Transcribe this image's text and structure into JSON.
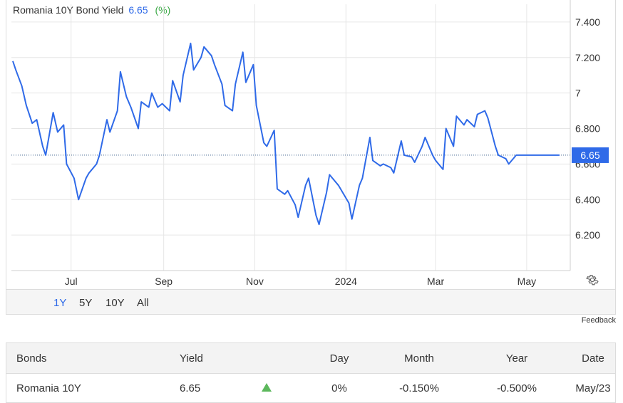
{
  "header": {
    "title": "Romania 10Y Bond Yield",
    "value": "6.65",
    "change": "(%)"
  },
  "colors": {
    "line": "#2f6ae8",
    "grid": "#e6e6e6",
    "last_label_bg": "#2f6ae8",
    "positive": "#3aa845"
  },
  "range_buttons": [
    {
      "label": "1Y",
      "active": true
    },
    {
      "label": "5Y",
      "active": false
    },
    {
      "label": "10Y",
      "active": false
    },
    {
      "label": "All",
      "active": false
    }
  ],
  "settings_icon": "gear-icon",
  "feedback_label": "Feedback",
  "chart_data": {
    "type": "line",
    "title": "Romania 10Y Bond Yield",
    "xlabel": "",
    "ylabel": "",
    "ylim": [
      6.0,
      7.5
    ],
    "yticks": [
      {
        "value": 6.2,
        "label": "6.200"
      },
      {
        "value": 6.4,
        "label": "6.400"
      },
      {
        "value": 6.6,
        "label": "6.600"
      },
      {
        "value": 6.8,
        "label": "6.800"
      },
      {
        "value": 7.0,
        "label": "7"
      },
      {
        "value": 7.2,
        "label": "7.200"
      },
      {
        "value": 7.4,
        "label": "7.400"
      }
    ],
    "xticks": [
      {
        "date": "2023-07-01",
        "label": "Jul"
      },
      {
        "date": "2023-09-01",
        "label": "Sep"
      },
      {
        "date": "2023-11-01",
        "label": "Nov"
      },
      {
        "date": "2024-01-01",
        "label": "2024"
      },
      {
        "date": "2024-03-01",
        "label": "Mar"
      },
      {
        "date": "2024-05-01",
        "label": "May"
      }
    ],
    "last_value": 6.65,
    "last_label": "6.65",
    "grid": true,
    "series": [
      {
        "x": [
          "2023-05-23",
          "2023-05-25",
          "2023-05-29",
          "2023-06-01",
          "2023-06-05",
          "2023-06-08",
          "2023-06-12",
          "2023-06-14",
          "2023-06-19",
          "2023-06-22",
          "2023-06-26",
          "2023-06-28",
          "2023-07-03",
          "2023-07-06",
          "2023-07-11",
          "2023-07-13",
          "2023-07-18",
          "2023-07-20",
          "2023-07-25",
          "2023-07-27",
          "2023-08-01",
          "2023-08-03",
          "2023-08-07",
          "2023-08-10",
          "2023-08-15",
          "2023-08-17",
          "2023-08-22",
          "2023-08-24",
          "2023-08-28",
          "2023-08-31",
          "2023-09-05",
          "2023-09-07",
          "2023-09-12",
          "2023-09-14",
          "2023-09-19",
          "2023-09-21",
          "2023-09-26",
          "2023-09-28",
          "2023-10-03",
          "2023-10-05",
          "2023-10-10",
          "2023-10-12",
          "2023-10-17",
          "2023-10-19",
          "2023-10-24",
          "2023-10-26",
          "2023-10-31",
          "2023-11-02",
          "2023-11-07",
          "2023-11-09",
          "2023-11-14",
          "2023-11-16",
          "2023-11-21",
          "2023-11-23",
          "2023-11-28",
          "2023-11-30",
          "2023-12-05",
          "2023-12-07",
          "2023-12-12",
          "2023-12-14",
          "2023-12-19",
          "2023-12-21",
          "2023-12-27",
          "2024-01-03",
          "2024-01-05",
          "2024-01-10",
          "2024-01-12",
          "2024-01-17",
          "2024-01-19",
          "2024-01-24",
          "2024-01-26",
          "2024-01-31",
          "2024-02-02",
          "2024-02-07",
          "2024-02-09",
          "2024-02-14",
          "2024-02-16",
          "2024-02-21",
          "2024-02-23",
          "2024-02-28",
          "2024-03-01",
          "2024-03-06",
          "2024-03-08",
          "2024-03-13",
          "2024-03-15",
          "2024-03-20",
          "2024-03-22",
          "2024-03-27",
          "2024-03-29",
          "2024-04-03",
          "2024-04-05",
          "2024-04-10",
          "2024-04-12",
          "2024-04-17",
          "2024-04-19",
          "2024-04-24",
          "2024-04-26",
          "2024-05-01",
          "2024-05-03",
          "2024-05-08",
          "2024-05-10",
          "2024-05-15",
          "2024-05-17",
          "2024-05-21",
          "2024-05-23"
        ],
        "values": [
          7.18,
          7.13,
          7.04,
          6.93,
          6.83,
          6.85,
          6.7,
          6.65,
          6.89,
          6.78,
          6.82,
          6.6,
          6.52,
          6.4,
          6.52,
          6.55,
          6.6,
          6.65,
          6.85,
          6.78,
          6.9,
          7.12,
          6.98,
          6.92,
          6.8,
          6.95,
          6.92,
          7.0,
          6.92,
          6.94,
          6.9,
          7.07,
          6.95,
          7.1,
          7.28,
          7.13,
          7.2,
          7.26,
          7.21,
          7.16,
          7.05,
          6.93,
          6.9,
          7.05,
          7.23,
          7.06,
          7.16,
          6.93,
          6.72,
          6.7,
          6.79,
          6.46,
          6.43,
          6.45,
          6.37,
          6.3,
          6.48,
          6.52,
          6.31,
          6.26,
          6.44,
          6.54,
          6.48,
          6.38,
          6.29,
          6.48,
          6.52,
          6.75,
          6.62,
          6.59,
          6.6,
          6.58,
          6.55,
          6.73,
          6.65,
          6.64,
          6.61,
          6.7,
          6.75,
          6.65,
          6.62,
          6.57,
          6.8,
          6.7,
          6.87,
          6.82,
          6.85,
          6.81,
          6.88,
          6.9,
          6.86,
          6.7,
          6.65,
          6.63,
          6.6,
          6.65,
          6.65,
          6.65,
          6.65,
          6.65,
          6.65,
          6.65,
          6.65,
          6.65,
          6.65
        ]
      }
    ]
  },
  "table": {
    "headers": [
      "Bonds",
      "Yield",
      "",
      "Day",
      "Month",
      "Year",
      "Date"
    ],
    "rows": [
      {
        "name": "Romania 10Y",
        "yield": "6.65",
        "direction": "up",
        "day": "0%",
        "month": "-0.150%",
        "year": "-0.500%",
        "date": "May/23"
      }
    ]
  }
}
